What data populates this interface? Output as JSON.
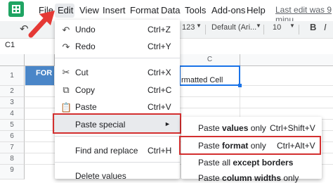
{
  "menubar": {
    "items": [
      "File",
      "Edit",
      "View",
      "Insert",
      "Format",
      "Data",
      "Tools",
      "Add-ons",
      "Help"
    ],
    "last_edit": "Last edit was 9 minu"
  },
  "toolbar": {
    "number_format": "123",
    "font": "Default (Ari...",
    "font_size": "10"
  },
  "namebox": {
    "value": "C1"
  },
  "grid": {
    "col_c": "C",
    "rows": [
      "1",
      "2",
      "3",
      "4",
      "5",
      "6",
      "7",
      "8",
      "9"
    ],
    "cell_a1_text": "FOR",
    "cell_c1_text": "rmatted Cell"
  },
  "edit_menu": {
    "items": [
      {
        "icon": "undo-icon",
        "label": "Undo",
        "shortcut": "Ctrl+Z"
      },
      {
        "icon": "redo-icon",
        "label": "Redo",
        "shortcut": "Ctrl+Y"
      },
      {
        "icon": "cut-icon",
        "label": "Cut",
        "shortcut": "Ctrl+X"
      },
      {
        "icon": "copy-icon",
        "label": "Copy",
        "shortcut": "Ctrl+C"
      },
      {
        "icon": "paste-icon",
        "label": "Paste",
        "shortcut": "Ctrl+V"
      },
      {
        "label": "Paste special",
        "shortcut": "►"
      },
      {
        "label": "Find and replace",
        "shortcut": "Ctrl+H"
      },
      {
        "label": "Delete values",
        "shortcut": ""
      }
    ]
  },
  "paste_special_menu": {
    "values_only": {
      "pre": "Paste ",
      "bold": "values",
      "post": " only",
      "shortcut": "Ctrl+Shift+V"
    },
    "format_only": {
      "pre": "Paste ",
      "bold": "format",
      "post": " only",
      "shortcut": "Ctrl+Alt+V"
    },
    "all_except_borders": {
      "pre": "Paste all ",
      "bold": "except borders",
      "post": ""
    },
    "column_widths_only": {
      "pre": "Paste ",
      "bold": "column widths",
      "post": " only"
    }
  },
  "colors": {
    "highlight": "#d32f2f",
    "arrow": "#e53935",
    "header_cell": "#4a86c8",
    "selection": "#1a73e8"
  }
}
